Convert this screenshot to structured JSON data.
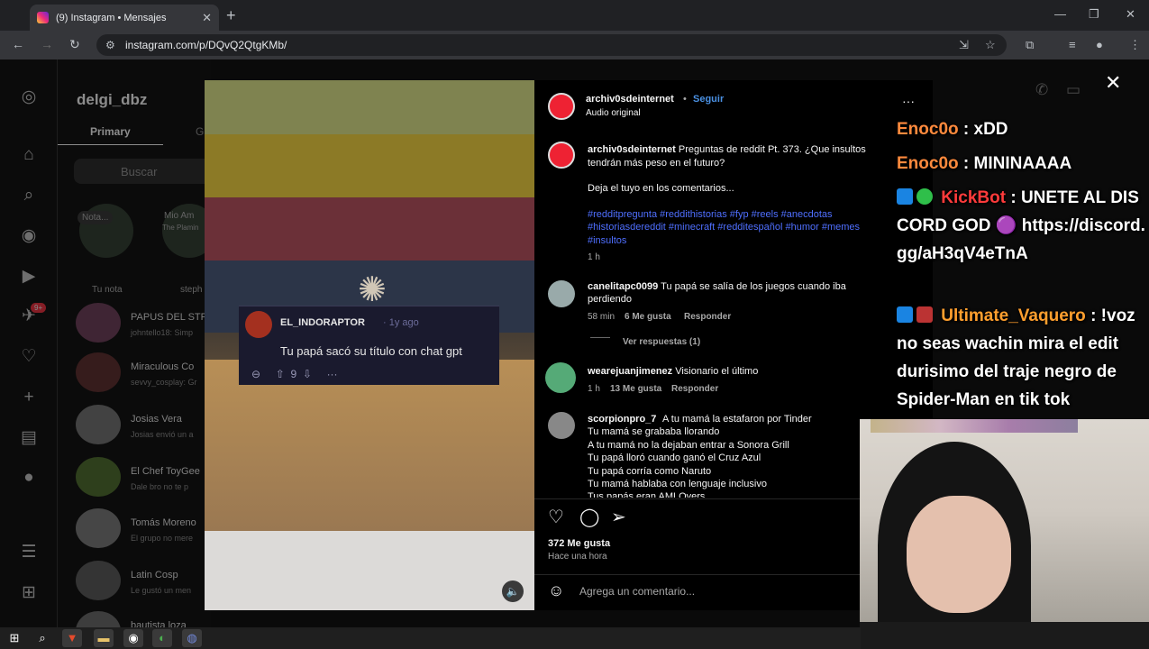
{
  "browser": {
    "tab_title": "(9) Instagram • Mensajes",
    "tab_close": "✕",
    "new_tab": "+",
    "url": "instagram.com/p/DQvQ2QtgKMb/",
    "window_controls": [
      "—",
      "❐",
      "✕"
    ]
  },
  "instagram": {
    "username": "delgi_dbz",
    "tab_primary": "Primary",
    "tab_general": "G",
    "search_placeholder": "Buscar",
    "notes": [
      {
        "label": "Tu nota",
        "bubble": "Nota..."
      },
      {
        "label": "steph",
        "bubble": "Mio Am"
      }
    ],
    "note_sub": "The Plamin",
    "unread_badge": "9+",
    "conversations": [
      {
        "name": "PAPUS DEL STR",
        "sub": "johntello18: Simp"
      },
      {
        "name": "Miraculous Co",
        "sub": "sevvy_cosplay: Gr"
      },
      {
        "name": "Josias Vera",
        "sub": "Josias envió un a"
      },
      {
        "name": "El Chef ToyGee",
        "sub": "Dale bro no te p"
      },
      {
        "name": "Tomás Moreno",
        "sub": "El grupo no mere"
      },
      {
        "name": "Latin Cosp",
        "sub": "Le gustó un men"
      },
      {
        "name": "bautista loza",
        "sub": ""
      }
    ]
  },
  "video": {
    "reddit_user": "EL_INDORAPTOR",
    "reddit_ago": "· 1y ago",
    "reddit_text": "Tu papá sacó su título con chat gpt",
    "reddit_votes": "9",
    "reddit_more": "···"
  },
  "post": {
    "author": "archiv0sdeinternet",
    "follow": "Seguir",
    "audio": "Audio original",
    "more": "···",
    "caption": "Preguntas de reddit Pt. 373. ¿Que insultos tendrán más peso en el futuro?",
    "caption2": "Deja el tuyo en los comentarios...",
    "hashtags_1": "#redditpregunta #reddithistorias #fyp #reels #anecdotas",
    "hashtags_2": "#historiasdereddit #minecraft #redditespañol #humor #memes",
    "hashtags_3": "#insultos",
    "time": "1 h",
    "comments": [
      {
        "user": "canelitapc0099",
        "text": "Tu papá se salía de los juegos cuando iba",
        "text2": "perdiendo",
        "time": "58 min",
        "likes": "6 Me gusta",
        "reply": "Responder",
        "replies": "Ver respuestas (1)"
      },
      {
        "user": "wearejuanjimenez",
        "text": "Visionario el último",
        "time": "1 h",
        "likes": "13 Me gusta",
        "reply": "Responder"
      },
      {
        "user": "scorpionpro_7",
        "lines": [
          "A tu mamá la estafaron por Tinder",
          "Tu mamá se grababa llorando",
          "A tu mamá no la dejaban entrar a Sonora Grill",
          "Tu papá lloró cuando ganó el Cruz Azul",
          "Tu papá corría como Naruto",
          "Tu mamá hablaba con lenguaje inclusivo",
          "Tus papás eran AMLOvers"
        ]
      }
    ],
    "likes": "372 Me gusta",
    "posted": "Hace una hora",
    "add_comment_placeholder": "Agrega un comentario..."
  },
  "stream_chat": {
    "lines": [
      {
        "nick": "Enoc0o",
        "msg": ": xDD"
      },
      {
        "nick": "Enoc0o",
        "msg": ": MININAAAA"
      },
      {
        "nick": "KickBot",
        "msg": ": UNETE AL DISCORD GOD 🟣 https://discord.gg/aH3qV4eTnA"
      },
      {
        "nick": "Ultimate_Vaquero",
        "msg": ": !voz no seas wachin mira el edit durisimo del traje negro de Spider-Man en tik tok"
      }
    ]
  },
  "colors": {
    "link_blue": "#4a90e2",
    "hashtag": "#4f6fff",
    "nick_enoc": "#ff8a3d",
    "nick_kick": "#ff3b3b",
    "nick_vaquero": "#ff9f2e"
  }
}
